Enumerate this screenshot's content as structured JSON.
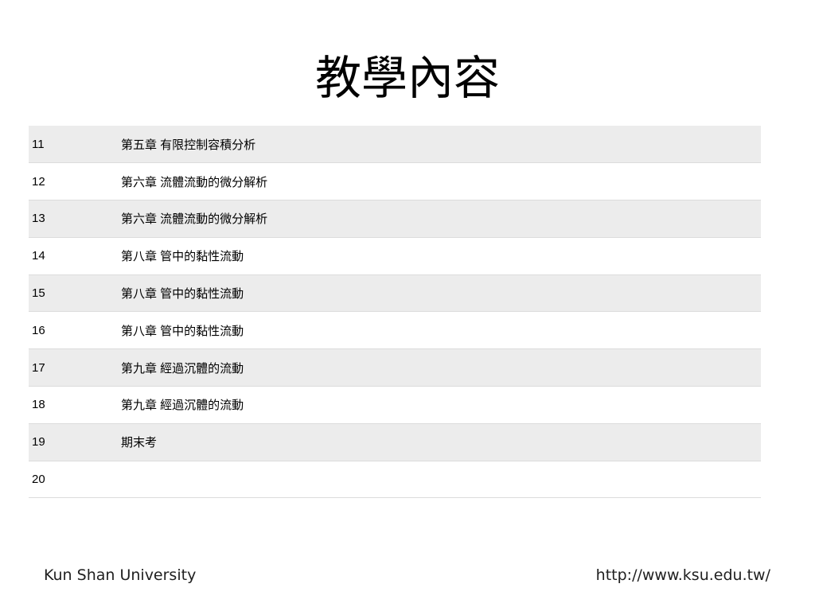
{
  "slide": {
    "title": "教學內容"
  },
  "schedule": {
    "rows": [
      {
        "week": "11",
        "content": "第五章 有限控制容積分析"
      },
      {
        "week": "12",
        "content": "第六章 流體流動的微分解析"
      },
      {
        "week": "13",
        "content": "第六章 流體流動的微分解析"
      },
      {
        "week": "14",
        "content": "第八章 管中的黏性流動"
      },
      {
        "week": "15",
        "content": "第八章 管中的黏性流動"
      },
      {
        "week": "16",
        "content": "第八章 管中的黏性流動"
      },
      {
        "week": "17",
        "content": "第九章 經過沉體的流動"
      },
      {
        "week": "18",
        "content": "第九章 經過沉體的流動"
      },
      {
        "week": "19",
        "content": "期末考"
      },
      {
        "week": "20",
        "content": ""
      }
    ]
  },
  "footer": {
    "institution": "Kun Shan University",
    "url": "http://www.ksu.edu.tw/"
  }
}
